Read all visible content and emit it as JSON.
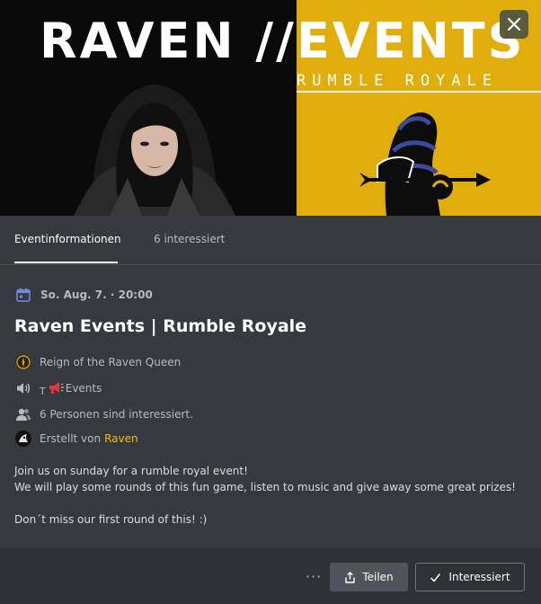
{
  "banner": {
    "title_left": "RAVEN //",
    "title_right": "EVENTS",
    "subtitle": "RUMBLE ROYALE",
    "colors": {
      "left_bg": "#0a0a0a",
      "right_bg": "#e0ad0a"
    }
  },
  "close": {
    "icon": "close-icon"
  },
  "tabs": [
    {
      "label": "Eventinformationen",
      "active": true
    },
    {
      "label": "6 interessiert",
      "active": false
    }
  ],
  "event": {
    "date": "So. Aug. 7. · 20:00",
    "title": "Raven Events | Rumble Royale",
    "server": "Reign of the Raven Queen",
    "channel_prefix": "T",
    "channel": "Events",
    "interested": "6 Personen sind interessiert.",
    "created_by_label": "Erstellt von",
    "creator": "Raven",
    "description_lines": [
      "Join us on sunday for a rumble royal event!",
      "We will play some rounds of this fun game, listen to music and give away some great prizes!",
      "Don´t miss our first round of this! :)"
    ]
  },
  "footer": {
    "more_label": "···",
    "share_label": "Teilen",
    "interested_label": "Interessiert"
  }
}
